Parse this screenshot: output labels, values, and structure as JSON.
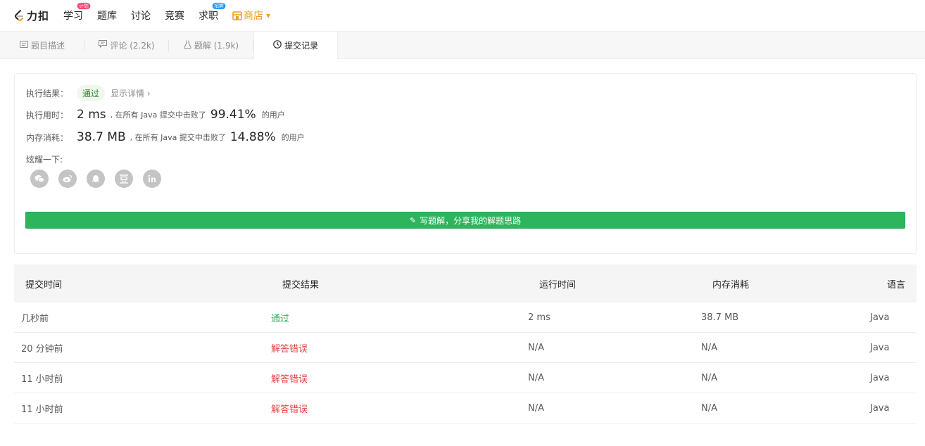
{
  "nav": {
    "logo_text": "力扣",
    "items": [
      {
        "label": "学习",
        "badge": "计划",
        "badge_color": "#f2456c"
      },
      {
        "label": "题库"
      },
      {
        "label": "讨论"
      },
      {
        "label": "竞赛"
      },
      {
        "label": "求职",
        "badge": "招聘",
        "badge_color": "#2196f3"
      }
    ],
    "store_label": "商店",
    "store_icon": "store-icon",
    "accent": "#f0a020"
  },
  "tabs": [
    {
      "label": "题目描述",
      "icon": "description-icon"
    },
    {
      "label": "评论 (2.2k)",
      "icon": "comment-icon"
    },
    {
      "label": "题解 (1.9k)",
      "icon": "flask-icon"
    },
    {
      "label": "提交记录",
      "icon": "clock-icon",
      "active": true
    }
  ],
  "result": {
    "status_label": "执行结果：",
    "status_value": "通过",
    "detail_link": "显示详情 ›",
    "time_label": "执行用时：",
    "time_value": "2 ms",
    "time_text": ", 在所有 Java 提交中击败了",
    "time_pct": "99.41%",
    "time_suffix": "的用户",
    "mem_label": "内存消耗：",
    "mem_value": "38.7 MB",
    "mem_text": ", 在所有 Java 提交中击败了",
    "mem_pct": "14.88%",
    "mem_suffix": "的用户",
    "share_label": "炫耀一下:",
    "share_icons": [
      "wechat-icon",
      "weibo-icon",
      "qq-icon",
      "douban-icon",
      "linkedin-icon"
    ],
    "write_button": "写题解，分享我的解题思路",
    "button_color": "#2db55d"
  },
  "table": {
    "headers": [
      "提交时间",
      "提交结果",
      "运行时间",
      "内存消耗",
      "语言"
    ],
    "rows": [
      {
        "time": "几秒前",
        "result": "通过",
        "status": "pass",
        "runtime": "2 ms",
        "memory": "38.7 MB",
        "lang": "Java"
      },
      {
        "time": "20 分钟前",
        "result": "解答错误",
        "status": "fail",
        "runtime": "N/A",
        "memory": "N/A",
        "lang": "Java"
      },
      {
        "time": "11 小时前",
        "result": "解答错误",
        "status": "fail",
        "runtime": "N/A",
        "memory": "N/A",
        "lang": "Java"
      },
      {
        "time": "11 小时前",
        "result": "解答错误",
        "status": "fail",
        "runtime": "N/A",
        "memory": "N/A",
        "lang": "Java"
      }
    ]
  }
}
